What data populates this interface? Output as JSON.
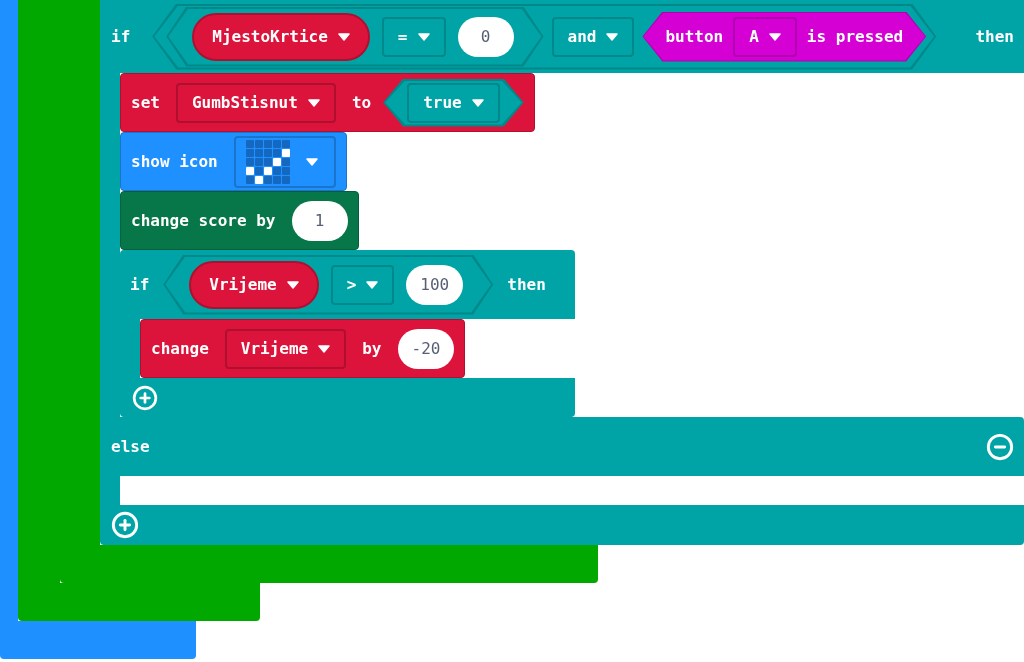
{
  "if_block": {
    "label": "if",
    "then_label": "then",
    "else_label": "else",
    "condition": {
      "compare": {
        "variable": "MjestoKrtice",
        "operator": "=",
        "value": "0"
      },
      "logic_operator": "and",
      "button_event": {
        "prefix": "button",
        "button": "A",
        "suffix": "is pressed"
      }
    },
    "then_statements": [
      {
        "kind": "set",
        "label": "set",
        "variable": "GumbStisnut",
        "to_label": "to",
        "value": "true"
      },
      {
        "kind": "show_icon",
        "label": "show icon",
        "pixels": [
          [
            false,
            false,
            false,
            false,
            false
          ],
          [
            false,
            false,
            false,
            false,
            true
          ],
          [
            false,
            false,
            false,
            true,
            false
          ],
          [
            true,
            false,
            true,
            false,
            false
          ],
          [
            false,
            true,
            false,
            false,
            false
          ]
        ]
      },
      {
        "kind": "change_score",
        "label": "change score by",
        "value": "1"
      },
      {
        "kind": "if",
        "label": "if",
        "then_label": "then",
        "condition": {
          "variable": "Vrijeme",
          "operator": ">",
          "value": "100"
        },
        "statements": [
          {
            "kind": "change",
            "label": "change",
            "variable": "Vrijeme",
            "by_label": "by",
            "value": "-20"
          }
        ]
      }
    ]
  }
}
